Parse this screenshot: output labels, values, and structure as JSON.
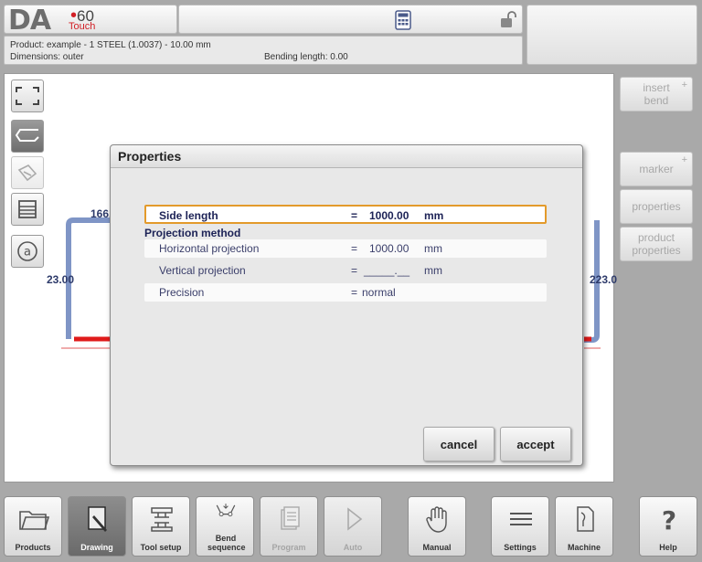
{
  "header": {
    "logo_main": "DA",
    "logo_number": "60",
    "logo_sub": "Touch"
  },
  "info": {
    "product": "Product: example - 1 STEEL (1.0037) - 10.00 mm",
    "dimensions": "Dimensions: outer",
    "bending_length": "Bending length: 0.00"
  },
  "drawing": {
    "left_label_top": "166.",
    "left_label_side": "23.00",
    "right_label_side": "223.0"
  },
  "side_buttons": {
    "insert_bend": "insert bend",
    "marker": "marker",
    "properties": "properties",
    "product_properties": "product properties"
  },
  "dialog": {
    "title": "Properties",
    "side_length": {
      "label": "Side length",
      "eq": "=",
      "value": "1000.00",
      "unit": "mm"
    },
    "group_title": "Projection method",
    "horizontal": {
      "label": "Horizontal projection",
      "eq": "=",
      "value": "1000.00",
      "unit": "mm"
    },
    "vertical": {
      "label": "Vertical projection",
      "eq": "=",
      "value": "_____.__",
      "unit": "mm"
    },
    "precision": {
      "label": "Precision",
      "eq": "=",
      "value": "normal"
    },
    "cancel": "cancel",
    "accept": "accept"
  },
  "nav": {
    "products": "Products",
    "drawing": "Drawing",
    "tool_setup": "Tool setup",
    "bend_sequence": "Bend sequence",
    "program": "Program",
    "auto": "Auto",
    "manual": "Manual",
    "settings": "Settings",
    "machine": "Machine",
    "help": "Help"
  },
  "colors": {
    "accent_red": "#d21f25",
    "selection_orange": "#e39a2b",
    "profile_blue": "#7f95c6"
  }
}
